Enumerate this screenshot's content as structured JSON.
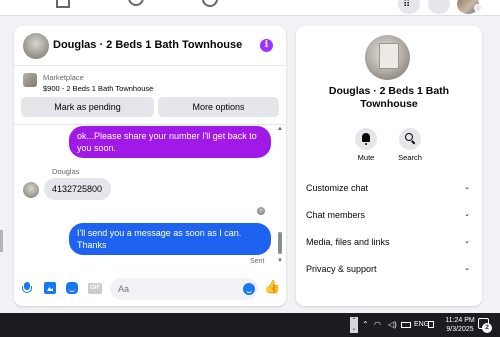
{
  "chat": {
    "title": "Douglas · 2 Beds 1 Bath Townhouse",
    "marketplace": {
      "label": "Marketplace",
      "listing": "$900 - 2 Beds 1 Bath Townhouse",
      "mark_pending": "Mark as pending",
      "more_options": "More options"
    },
    "messages": [
      {
        "from": "me",
        "text": "ok...Please share your number I'll get back to you soon."
      },
      {
        "from": "Douglas",
        "sender_label": "Douglas",
        "text": "4132725800"
      },
      {
        "from": "me",
        "text": "I'll send you a message as soon as I can. Thanks",
        "status": "Sent"
      }
    ],
    "composer": {
      "placeholder": "Aa",
      "gif_label": "GIF"
    }
  },
  "info_panel": {
    "title": "Douglas · 2 Beds 1 Bath Townhouse",
    "actions": [
      {
        "label": "Mute",
        "icon": "bell-icon"
      },
      {
        "label": "Search",
        "icon": "search-icon"
      }
    ],
    "sections": [
      {
        "label": "Customize chat"
      },
      {
        "label": "Chat members"
      },
      {
        "label": "Media, files and links"
      },
      {
        "label": "Privacy & support"
      }
    ]
  },
  "taskbar": {
    "language": "ENG",
    "time": "11:24 PM",
    "date": "9/3/2025",
    "notification_count": "2"
  },
  "colors": {
    "accent": "#1877f2",
    "bubble_purple": "#a019e6",
    "bubble_blue": "#1e63f0",
    "info_purple": "#a033ff"
  }
}
